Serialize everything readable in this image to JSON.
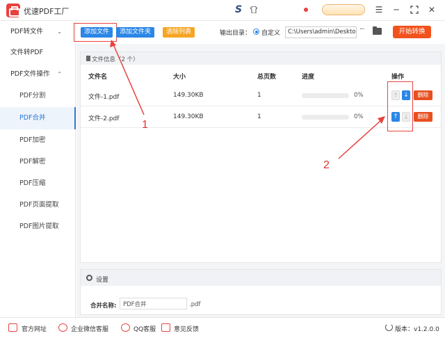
{
  "app": {
    "title": "优速PDF工厂"
  },
  "sidebar": {
    "groups": [
      {
        "label": "PDF转文件",
        "chevron": "⌄"
      },
      {
        "label": "文件转PDF",
        "chevron": ""
      },
      {
        "label": "PDF文件操作",
        "chevron": "⌃"
      }
    ],
    "items": [
      {
        "label": "PDF分割",
        "active": false
      },
      {
        "label": "PDF合并",
        "active": true
      },
      {
        "label": "PDF加密",
        "active": false
      },
      {
        "label": "PDF解密",
        "active": false
      },
      {
        "label": "PDF压缩",
        "active": false
      },
      {
        "label": "PDF页面提取",
        "active": false
      },
      {
        "label": "PDF图片提取",
        "active": false
      }
    ]
  },
  "toolbar": {
    "add_file": "添加文件",
    "add_folder": "添加文件夹",
    "clear_list": "清除列表",
    "output_label": "输出目录：",
    "custom_label": "自定义",
    "output_path": "C:\\Users\\admin\\Deskto",
    "more": "···",
    "start": "开始转换"
  },
  "file_panel": {
    "title": "文件信息（2 个）",
    "columns": {
      "name": "文件名",
      "size": "大小",
      "pages": "总页数",
      "progress": "进度",
      "action": "操作"
    },
    "rows": [
      {
        "name": "文件-1.pdf",
        "size": "149.30KB",
        "pages": "1",
        "progress": 0,
        "progress_text": "0%",
        "up_enabled": false,
        "down_enabled": true,
        "delete": "删除"
      },
      {
        "name": "文件-2.pdf",
        "size": "149.30KB",
        "pages": "1",
        "progress": 0,
        "progress_text": "0%",
        "up_enabled": true,
        "down_enabled": false,
        "delete": "删除"
      }
    ]
  },
  "annotations": {
    "one": "1",
    "two": "2"
  },
  "settings": {
    "title": "设置",
    "merge_label": "合并名称:",
    "merge_value": "PDF合并",
    "merge_ext": ".pdf"
  },
  "footer": {
    "website": "官方网址",
    "wechat": "企业微信客服",
    "qq": "QQ客服",
    "feedback": "意见反馈",
    "version": "版本：v1.2.0.0"
  },
  "colors": {
    "accent": "#2b86e6",
    "start": "#f2521d",
    "delete": "#e8501f",
    "highlight": "#e8423f"
  }
}
